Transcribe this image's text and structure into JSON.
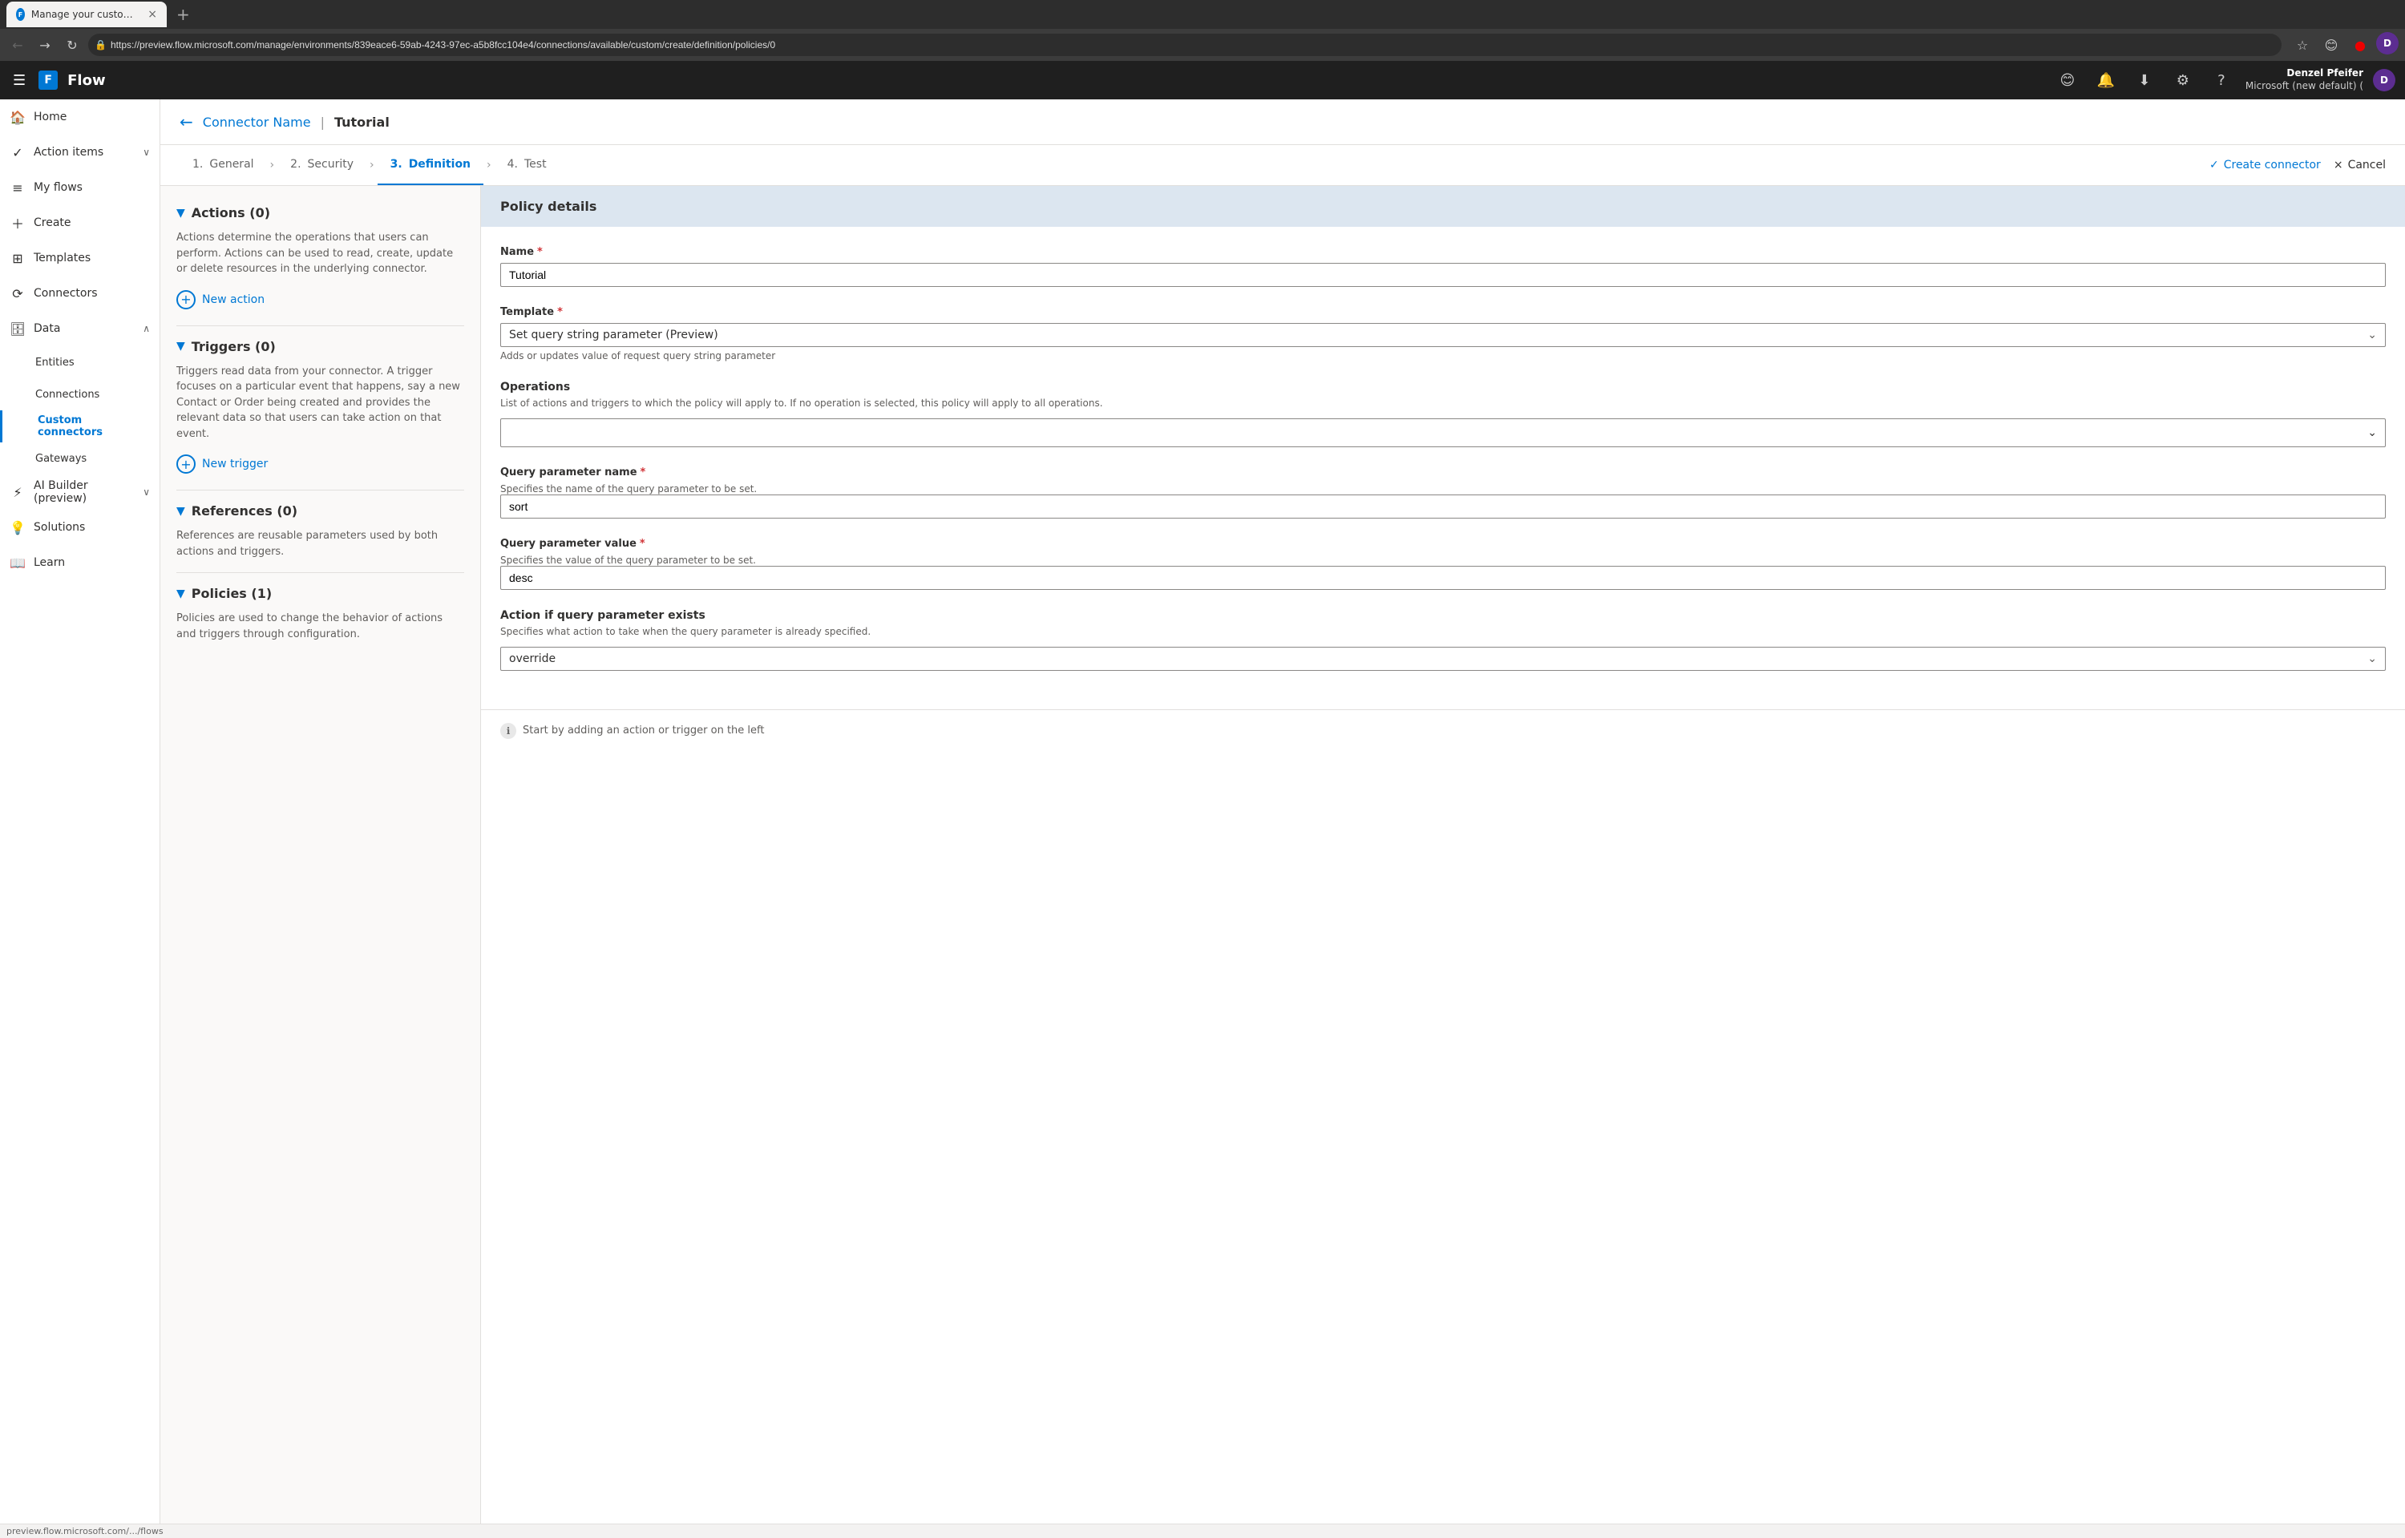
{
  "browser": {
    "tab_title": "Manage your custom connectors",
    "url": "https://preview.flow.microsoft.com/manage/environments/839eace6-59ab-4243-97ec-a5b8fcc104e4/connections/available/custom/create/definition/policies/0",
    "new_tab_label": "+",
    "tab_close": "×",
    "nav_back": "←",
    "nav_forward": "→",
    "nav_refresh": "↻",
    "favicon_letter": "F"
  },
  "topbar": {
    "app_name": "Flow",
    "user_name": "Denzel Pfeifer",
    "user_tenant": "Microsoft (new default) (",
    "user_avatar_letter": "D"
  },
  "sidebar": {
    "items": [
      {
        "id": "home",
        "label": "Home",
        "icon": "🏠",
        "active": false
      },
      {
        "id": "action-items",
        "label": "Action items",
        "icon": "✓",
        "active": false,
        "has_chevron": true
      },
      {
        "id": "my-flows",
        "label": "My flows",
        "icon": "≡",
        "active": false
      },
      {
        "id": "create",
        "label": "Create",
        "icon": "+",
        "active": false
      },
      {
        "id": "templates",
        "label": "Templates",
        "icon": "⊞",
        "active": false
      },
      {
        "id": "connectors",
        "label": "Connectors",
        "icon": "⟳",
        "active": false
      },
      {
        "id": "data",
        "label": "Data",
        "icon": "🗄",
        "active": false,
        "has_chevron": true,
        "expanded": true
      },
      {
        "id": "ai-builder",
        "label": "AI Builder (preview)",
        "icon": "⚡",
        "active": false,
        "has_chevron": true
      },
      {
        "id": "solutions",
        "label": "Solutions",
        "icon": "💡",
        "active": false
      },
      {
        "id": "learn",
        "label": "Learn",
        "icon": "📖",
        "active": false
      }
    ],
    "subitems": [
      {
        "id": "entities",
        "label": "Entities",
        "active": false
      },
      {
        "id": "connections",
        "label": "Connections",
        "active": false
      },
      {
        "id": "custom-connectors",
        "label": "Custom connectors",
        "active": true
      },
      {
        "id": "gateways",
        "label": "Gateways",
        "active": false
      }
    ]
  },
  "breadcrumb": {
    "back_btn": "←",
    "connector_name": "Connector Name",
    "separator": "|",
    "page_title": "Tutorial"
  },
  "wizard": {
    "tabs": [
      {
        "id": "general",
        "step": "1.",
        "label": "General",
        "active": false
      },
      {
        "id": "security",
        "step": "2.",
        "label": "Security",
        "active": false
      },
      {
        "id": "definition",
        "step": "3.",
        "label": "Definition",
        "active": true
      },
      {
        "id": "test",
        "step": "4.",
        "label": "Test",
        "active": false
      }
    ],
    "create_connector_label": "Create connector",
    "cancel_label": "Cancel"
  },
  "left_panel": {
    "actions_section": {
      "title": "Actions (0)",
      "description": "Actions determine the operations that users can perform. Actions can be used to read, create, update or delete resources in the underlying connector.",
      "new_action_label": "New action"
    },
    "triggers_section": {
      "title": "Triggers (0)",
      "description": "Triggers read data from your connector. A trigger focuses on a particular event that happens, say a new Contact or Order being created and provides the relevant data so that users can take action on that event.",
      "new_trigger_label": "New trigger"
    },
    "references_section": {
      "title": "References (0)",
      "description": "References are reusable parameters used by both actions and triggers."
    },
    "policies_section": {
      "title": "Policies (1)",
      "description": "Policies are used to change the behavior of actions and triggers through configuration."
    }
  },
  "right_panel": {
    "header": "Policy details",
    "name_label": "Name",
    "name_required": "*",
    "name_value": "Tutorial",
    "template_label": "Template",
    "template_required": "*",
    "template_value": "Set query string parameter (Preview)",
    "template_hint": "Adds or updates value of request query string parameter",
    "operations_label": "Operations",
    "operations_hint": "List of actions and triggers to which the policy will apply to. If no operation is selected, this policy will apply to all operations.",
    "query_param_name_label": "Query parameter name",
    "query_param_name_required": "*",
    "query_param_name_hint": "Specifies the name of the query parameter to be set.",
    "query_param_name_value": "sort",
    "query_param_value_label": "Query parameter value",
    "query_param_value_required": "*",
    "query_param_value_hint": "Specifies the value of the query parameter to be set.",
    "query_param_value_value": "desc",
    "action_if_exists_label": "Action if query parameter exists",
    "action_if_exists_hint": "Specifies what action to take when the query parameter is already specified.",
    "action_if_exists_value": "override",
    "bottom_hint": "Start by adding an action or trigger on the left"
  },
  "statusbar": {
    "url": "preview.flow.microsoft.com/.../flows"
  }
}
